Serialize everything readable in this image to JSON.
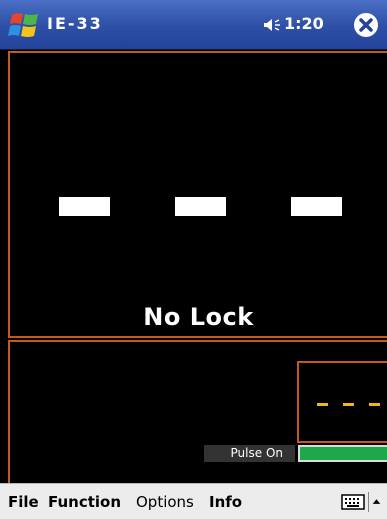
{
  "titlebar": {
    "app_title": "IE-33",
    "clock": "1:20",
    "start_icon": "windows-flag-icon",
    "volume_icon": "speaker-icon",
    "close_icon": "close-icon"
  },
  "display": {
    "readout": [
      "—",
      "—",
      "—"
    ],
    "status": "No Lock"
  },
  "mini_display": {
    "readout": "- - -"
  },
  "pulse": {
    "label": "Pulse On",
    "bar_color": "#1da84a"
  },
  "menu": {
    "items": [
      {
        "label": "File",
        "bold": true
      },
      {
        "label": "Function",
        "bold": true
      },
      {
        "label": "Options",
        "bold": false
      },
      {
        "label": "Info",
        "bold": true
      }
    ],
    "keyboard_icon": "keyboard-icon",
    "sip_icon": "up-arrow-icon"
  },
  "colors": {
    "titlebar": "#2d4fa6",
    "frame_accent": "#c65a1a",
    "mini_dash": "#f2b615",
    "background": "#000000"
  }
}
